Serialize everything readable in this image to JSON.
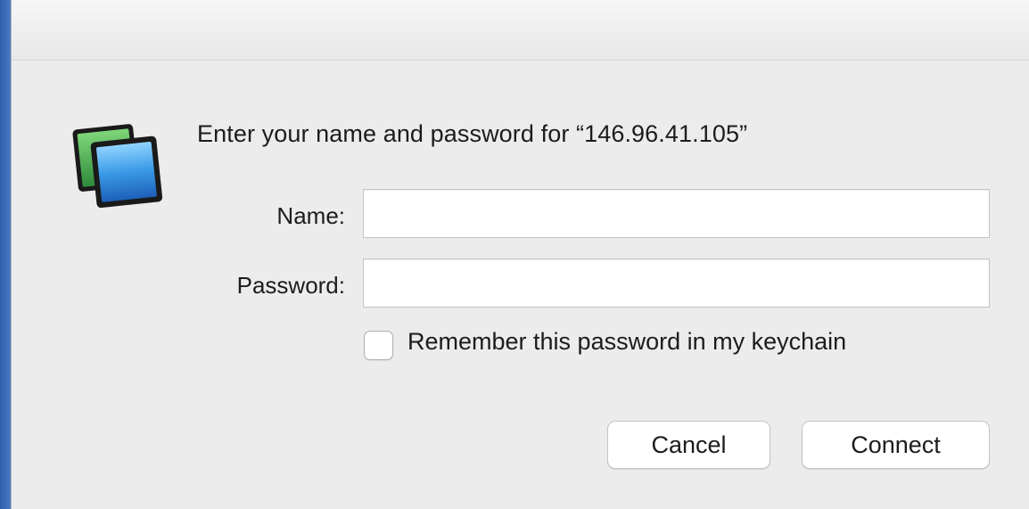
{
  "dialog": {
    "icon": "screen-sharing-icon",
    "prompt": "Enter your name and password for “146.96.41.105”",
    "fields": {
      "name_label": "Name:",
      "name_value": "",
      "password_label": "Password:",
      "password_value": ""
    },
    "remember": {
      "label": "Remember this password in my keychain",
      "checked": false
    },
    "buttons": {
      "cancel": "Cancel",
      "connect": "Connect"
    }
  }
}
